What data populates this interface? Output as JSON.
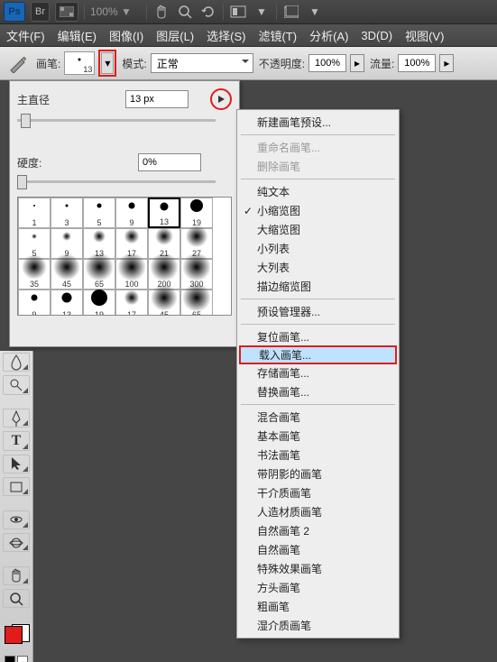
{
  "topbar": {
    "ps_label": "Ps",
    "br_label": "Br",
    "zoom": "100%  ▼"
  },
  "menu": {
    "items": [
      "文件(F)",
      "编辑(E)",
      "图像(I)",
      "图层(L)",
      "选择(S)",
      "滤镜(T)",
      "分析(A)",
      "3D(D)",
      "视图(V)"
    ]
  },
  "opt": {
    "brush_label": "画笔:",
    "brush_size_small": "13",
    "mode_label": "模式:",
    "mode_value": "正常",
    "opacity_label": "不透明度:",
    "opacity_value": "100%",
    "flow_label": "流量:",
    "flow_value": "100%"
  },
  "panel": {
    "diameter_label": "主直径",
    "diameter_value": "13 px",
    "hardness_label": "硬度:",
    "hardness_value": "0%",
    "brushes": [
      {
        "v": "1",
        "d": 2,
        "t": "dot"
      },
      {
        "v": "3",
        "d": 3,
        "t": "dot"
      },
      {
        "v": "5",
        "d": 5,
        "t": "dot"
      },
      {
        "v": "9",
        "d": 7,
        "t": "dot"
      },
      {
        "v": "13",
        "d": 9,
        "t": "dot",
        "sel": true
      },
      {
        "v": "19",
        "d": 14,
        "t": "dot"
      },
      {
        "v": "5",
        "d": 6,
        "t": "blur"
      },
      {
        "v": "9",
        "d": 10,
        "t": "blur"
      },
      {
        "v": "13",
        "d": 14,
        "t": "blur"
      },
      {
        "v": "17",
        "d": 17,
        "t": "blur"
      },
      {
        "v": "21",
        "d": 20,
        "t": "blur"
      },
      {
        "v": "27",
        "d": 25,
        "t": "blur"
      },
      {
        "v": "35",
        "d": 28,
        "t": "blur"
      },
      {
        "v": "45",
        "d": 30,
        "t": "blur"
      },
      {
        "v": "65",
        "d": 32,
        "t": "blur"
      },
      {
        "v": "100",
        "d": 32,
        "t": "blur"
      },
      {
        "v": "200",
        "d": 32,
        "t": "blur"
      },
      {
        "v": "300",
        "d": 32,
        "t": "blur"
      },
      {
        "v": "9",
        "d": 7,
        "t": "dot"
      },
      {
        "v": "13",
        "d": 11,
        "t": "dot"
      },
      {
        "v": "19",
        "d": 18,
        "t": "dot"
      },
      {
        "v": "17",
        "d": 17,
        "t": "blur"
      },
      {
        "v": "45",
        "d": 30,
        "t": "blur"
      },
      {
        "v": "65",
        "d": 32,
        "t": "blur"
      }
    ]
  },
  "ctx": {
    "groups": [
      [
        "新建画笔预设..."
      ],
      [
        "重命名画笔...",
        "删除画笔"
      ],
      [
        "纯文本",
        "小缩览图",
        "大缩览图",
        "小列表",
        "大列表",
        "描边缩览图"
      ],
      [
        "预设管理器..."
      ],
      [
        "复位画笔...",
        "载入画笔...",
        "存储画笔...",
        "替换画笔..."
      ],
      [
        "混合画笔",
        "基本画笔",
        "书法画笔",
        "带阴影的画笔",
        "干介质画笔",
        "人造材质画笔",
        "自然画笔 2",
        "自然画笔",
        "特殊效果画笔",
        "方头画笔",
        "粗画笔",
        "湿介质画笔"
      ]
    ],
    "disabled": [
      "重命名画笔...",
      "删除画笔"
    ],
    "checked": "小缩览图",
    "highlight": "载入画笔..."
  }
}
